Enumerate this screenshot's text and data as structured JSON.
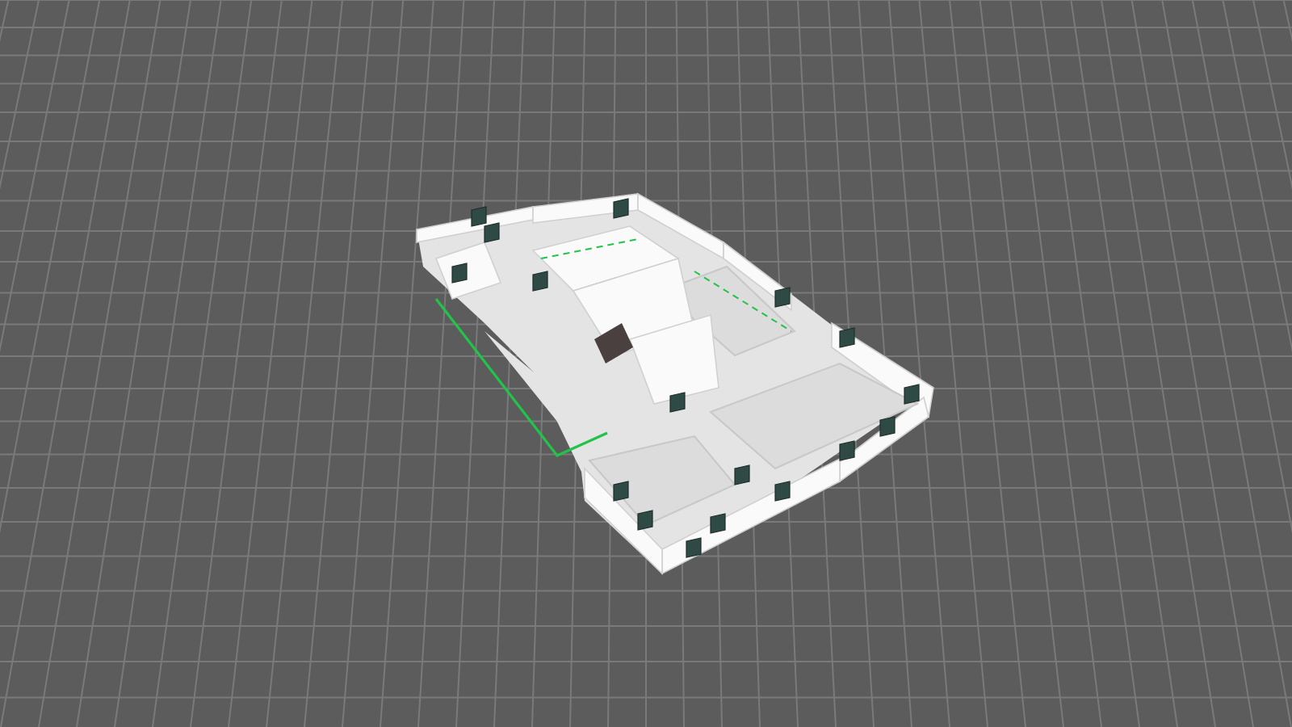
{
  "viewport": {
    "kind": "floorplan"
  }
}
